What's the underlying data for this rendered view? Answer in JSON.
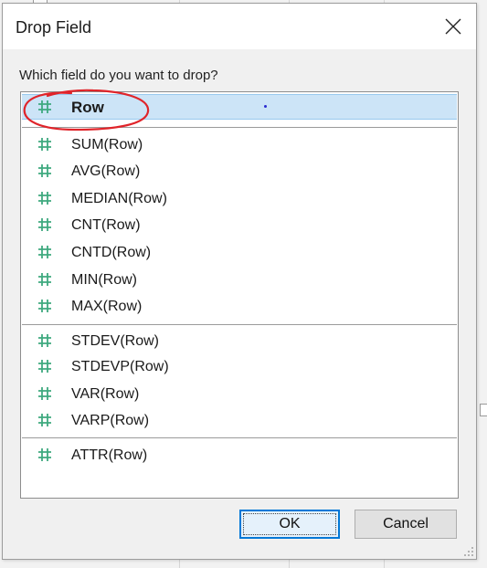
{
  "dialog": {
    "title": "Drop Field",
    "close_icon": "close-icon",
    "prompt": "Which field do you want to drop?",
    "field_icon": "hash-number-icon",
    "field_icon_color": "#3fa97f",
    "selection_color": "#cce4f7",
    "annotation_color": "#e0242a",
    "options": [
      {
        "label": "Row",
        "selected": true
      },
      {
        "label": "SUM(Row)"
      },
      {
        "label": "AVG(Row)"
      },
      {
        "label": "MEDIAN(Row)"
      },
      {
        "label": "CNT(Row)"
      },
      {
        "label": "CNTD(Row)"
      },
      {
        "label": "MIN(Row)"
      },
      {
        "label": "MAX(Row)"
      },
      {
        "label": "STDEV(Row)"
      },
      {
        "label": "STDEVP(Row)"
      },
      {
        "label": "VAR(Row)"
      },
      {
        "label": "VARP(Row)"
      },
      {
        "label": "ATTR(Row)"
      }
    ],
    "buttons": {
      "ok": "OK",
      "cancel": "Cancel"
    }
  }
}
